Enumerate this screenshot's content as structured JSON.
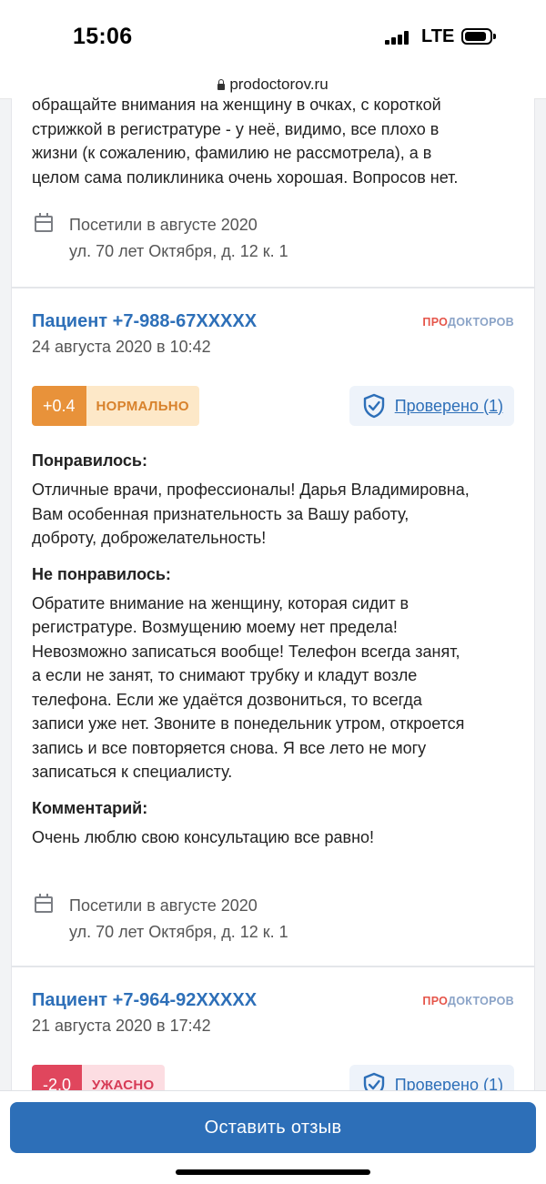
{
  "status_bar": {
    "time": "15:06",
    "network": "LTE"
  },
  "browser": {
    "url": "prodoctorov.ru"
  },
  "brand": {
    "part1": "ПРО",
    "part2": "ДОКТОРОВ"
  },
  "reviews": [
    {
      "text_lines": [
        "обращайте внимания на женщину в очках, с короткой",
        "стрижкой в регистратуре - у неё, видимо, все плохо в",
        "жизни (к сожалению, фамилию не рассмотрела), а в",
        "целом сама поликлиника очень хорошая. Вопросов нет."
      ],
      "visit": "Посетили в августе 2020",
      "address": "ул. 70 лет Октября, д. 12 к. 1"
    },
    {
      "author": "Пациент +7-988-67XXXXX",
      "date": "24 августа 2020 в 10:42",
      "rating_value": "+0.4",
      "rating_label": "НОРМАЛЬНО",
      "rating_color": "#e8923a",
      "verified": "Проверено (1)",
      "liked_heading": "Понравилось:",
      "liked_lines": [
        "Отличные врачи, профессионалы! Дарья Владимировна,",
        "Вам особенная признательность за Вашу работу,",
        "доброту, доброжелательность!"
      ],
      "disliked_heading": "Не понравилось:",
      "disliked_lines": [
        "Обратите внимание на женщину, которая сидит в",
        "регистратуре. Возмущению моему нет предела!",
        "Невозможно записаться вообще! Телефон всегда занят,",
        "а если не занят, то снимают трубку и кладут возле",
        "телефона. Если же удаётся дозвониться, то всегда",
        "записи уже нет. Звоните в понедельник утром, откроется",
        "запись и все повторяется снова. Я все лето не могу",
        "записаться к специалисту."
      ],
      "comment_heading": "Комментарий:",
      "comment_lines": [
        "Очень люблю свою консультацию все равно!"
      ],
      "visit": "Посетили в августе 2020",
      "address": "ул. 70 лет Октября, д. 12 к. 1"
    },
    {
      "author": "Пациент +7-964-92XXXXX",
      "date": "21 августа 2020 в 17:42",
      "rating_value": "-2.0",
      "rating_label": "УЖАСНО",
      "rating_color": "#e0465d",
      "verified": "Проверено (1)"
    }
  ],
  "cta": {
    "label": "Оставить отзыв"
  }
}
